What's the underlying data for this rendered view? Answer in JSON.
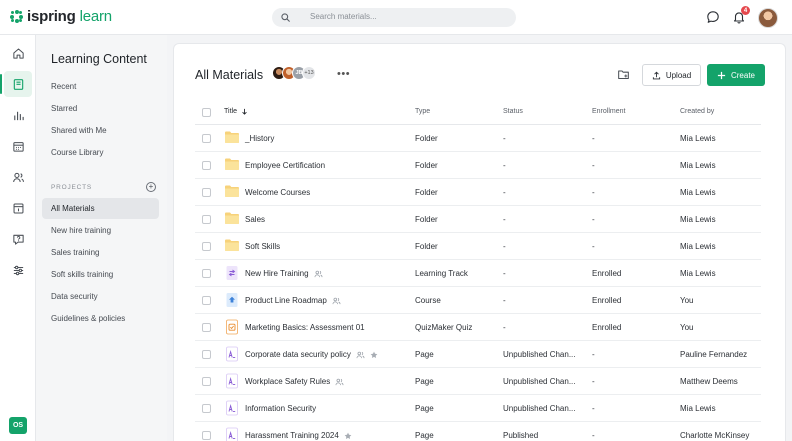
{
  "brand": {
    "logo_prefix": "ispring",
    "logo_suffix": "learn",
    "accent": "#14a36a"
  },
  "search": {
    "placeholder": "Search materials..."
  },
  "topbar": {
    "notification_count": "4"
  },
  "rail": {
    "items": [
      "home-icon",
      "book-icon",
      "chart-icon",
      "calendar-icon",
      "users-icon",
      "library-icon",
      "help-icon",
      "settings-icon"
    ],
    "user_initials": "OS"
  },
  "sidebar": {
    "title": "Learning Content",
    "items": [
      "Recent",
      "Starred",
      "Shared with Me",
      "Course Library"
    ],
    "projects_label": "PROJECTS",
    "projects": [
      "All Materials",
      "New hire training",
      "Sales training",
      "Soft skills training",
      "Data security",
      "Guidelines & policies"
    ]
  },
  "main": {
    "title": "All Materials",
    "avatar_initials": "JB",
    "extra_members": "+13",
    "upload_label": "Upload",
    "create_label": "Create"
  },
  "table": {
    "headers": {
      "title": "Title",
      "type": "Type",
      "status": "Status",
      "enrollment": "Enrollment",
      "created_by": "Created by"
    },
    "rows": [
      {
        "title": "_History",
        "icon": "folder",
        "type": "Folder",
        "status": "-",
        "enrollment": "-",
        "created_by": "Mia Lewis",
        "shared": false,
        "starred": false
      },
      {
        "title": "Employee Certification",
        "icon": "folder",
        "type": "Folder",
        "status": "-",
        "enrollment": "-",
        "created_by": "Mia Lewis",
        "shared": false,
        "starred": false
      },
      {
        "title": "Welcome Courses",
        "icon": "folder",
        "type": "Folder",
        "status": "-",
        "enrollment": "-",
        "created_by": "Mia Lewis",
        "shared": false,
        "starred": false
      },
      {
        "title": "Sales",
        "icon": "folder",
        "type": "Folder",
        "status": "-",
        "enrollment": "-",
        "created_by": "Mia Lewis",
        "shared": false,
        "starred": false
      },
      {
        "title": "Soft Skills",
        "icon": "folder",
        "type": "Folder",
        "status": "-",
        "enrollment": "-",
        "created_by": "Mia Lewis",
        "shared": false,
        "starred": false
      },
      {
        "title": "New Hire Training",
        "icon": "track",
        "type": "Learning Track",
        "status": "-",
        "enrollment": "Enrolled",
        "created_by": "Mia Lewis",
        "shared": true,
        "starred": false
      },
      {
        "title": "Product Line Roadmap",
        "icon": "course",
        "type": "Course",
        "status": "-",
        "enrollment": "Enrolled",
        "created_by": "You",
        "shared": true,
        "starred": false
      },
      {
        "title": "Marketing Basics: Assessment 01",
        "icon": "quiz",
        "type": "QuizMaker Quiz",
        "status": "-",
        "enrollment": "Enrolled",
        "created_by": "You",
        "shared": false,
        "starred": false
      },
      {
        "title": "Corporate data security policy",
        "icon": "page",
        "type": "Page",
        "status": "Unpublished Chan...",
        "enrollment": "-",
        "created_by": "Pauline Fernandez",
        "shared": true,
        "starred": true
      },
      {
        "title": "Workplace Safety Rules",
        "icon": "page",
        "type": "Page",
        "status": "Unpublished Chan...",
        "enrollment": "-",
        "created_by": "Matthew Deems",
        "shared": true,
        "starred": false
      },
      {
        "title": "Information Security",
        "icon": "page",
        "type": "Page",
        "status": "Unpublished Chan...",
        "enrollment": "-",
        "created_by": "Mia Lewis",
        "shared": false,
        "starred": false
      },
      {
        "title": "Harassment Training 2024",
        "icon": "page",
        "type": "Page",
        "status": "Published",
        "enrollment": "-",
        "created_by": "Charlotte McKinsey",
        "shared": false,
        "starred": true
      }
    ]
  }
}
